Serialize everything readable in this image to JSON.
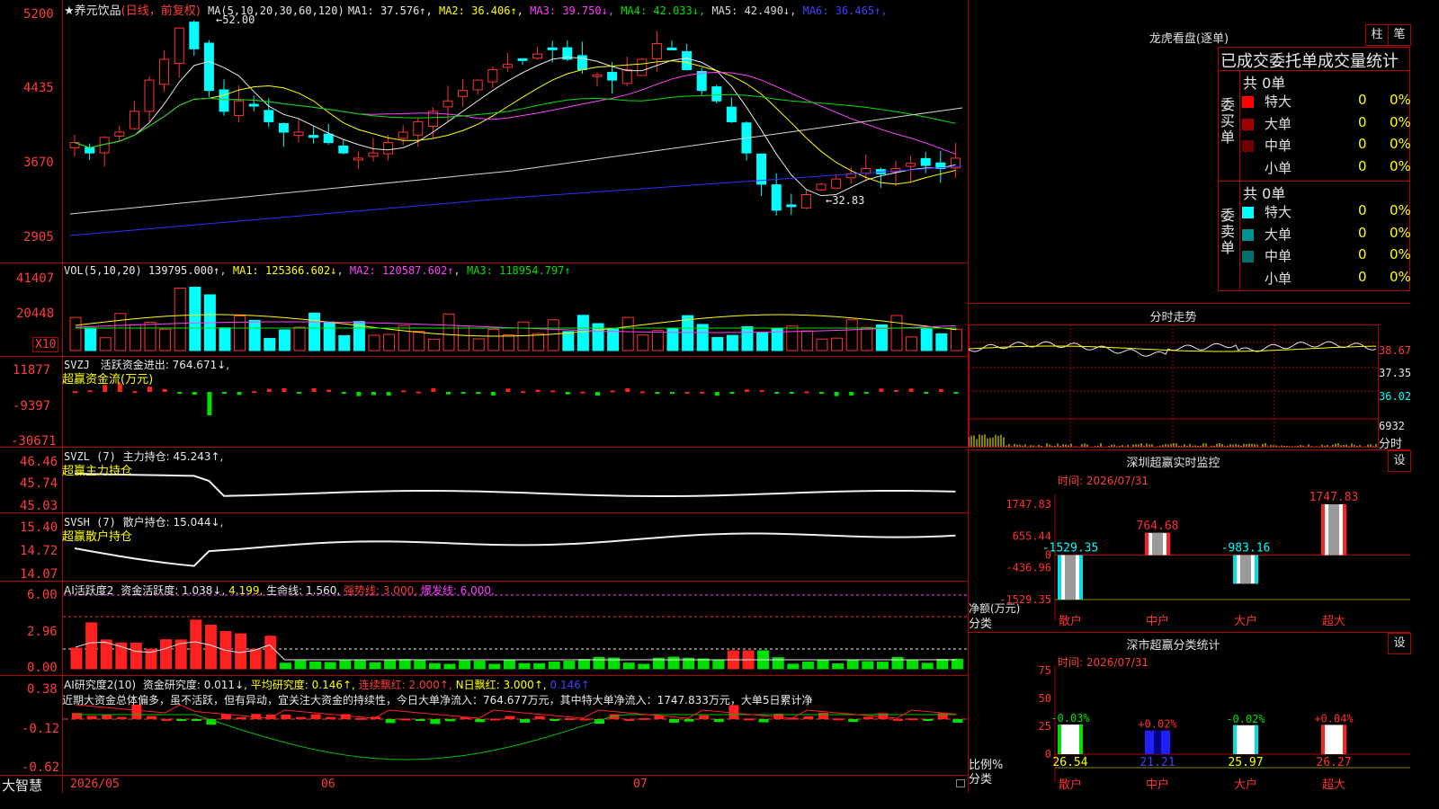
{
  "stock": {
    "star": "★",
    "name": "养元饮品",
    "mode": "(日线，前复权)"
  },
  "ma_line": {
    "prefix": "MA(5,10,20,30,60,120)",
    "items": [
      {
        "label": "MA1: 37.576↑",
        "color": "#e8e8e8"
      },
      {
        "label": "MA2: 36.406↑",
        "color": "#ffff00"
      },
      {
        "label": "MA3: 39.750↓",
        "color": "#ff40ff"
      },
      {
        "label": "MA4: 42.033↓",
        "color": "#00e000"
      },
      {
        "label": "MA5: 42.490↓",
        "color": "#d8d8d8"
      },
      {
        "label": "MA6: 36.465↑",
        "color": "#4040ff"
      }
    ]
  },
  "price_axis": [
    "5200",
    "4435",
    "3670",
    "2905"
  ],
  "price_marks": {
    "high": "52.00",
    "low": "32.83"
  },
  "vol_line": {
    "prefix": "VOL(5,10,20)",
    "value": "139795.000↑",
    "ma1": "MA1: 125366.602↓",
    "ma2": "MA2: 120587.602↑",
    "ma3": "MA3: 118954.797↑"
  },
  "vol_axis": [
    "41407",
    "20448"
  ],
  "vol_unit": "X10",
  "svzj": {
    "title": "SVZJ",
    "label": "活跃资金进出: 764.671↓,",
    "sub": "超赢资金流(万元)",
    "axis": [
      "11877",
      "-9397",
      "-30671"
    ]
  },
  "svzl": {
    "title": "SVZL (7)",
    "label": "主力持仓: 45.243↑,",
    "sub": "超赢主力持仓",
    "axis": [
      "46.46",
      "45.74",
      "45.03"
    ]
  },
  "svsh": {
    "title": "SVSH (7)",
    "label": "散户持仓: 15.044↓,",
    "sub": "超赢散户持仓",
    "axis": [
      "15.40",
      "14.72",
      "14.07"
    ]
  },
  "ai_active": {
    "title": "AI活跃度2",
    "l1": "资金活跃度: 1.038↓,",
    "l2": "4.199,",
    "l3": "生命线: 1.560,",
    "l4": "强势线: 3.000,",
    "l5": "爆发线: 6.000,",
    "axis": [
      "6.00",
      "2.96",
      "0.00"
    ]
  },
  "ai_research": {
    "title": "AI研究度2(10)",
    "l1": "资金研究度: 0.011↓,",
    "l2": "平均研究度: 0.146↑,",
    "l3": "连续飘红: 2.000↑,",
    "l4": "N日飘红: 3.000↑,",
    "l5": "0.146↑",
    "comment": "近期大资金总体偏多，虽不活跃，但有异动，宜关注大资金的持续性，今日大单净流入：764.677万元，其中特大单净流入：1747.833万元，大单5日累计净",
    "axis": [
      "0.38",
      "-0.12",
      "-0.62"
    ]
  },
  "bottom": {
    "brand": "大智慧",
    "dates": [
      "2026/05",
      "06",
      "07"
    ]
  },
  "dragon": {
    "title": "龙虎看盘(逐单)",
    "btn1": "柱",
    "btn2": "笔",
    "header": "已成交委托单成交量统计",
    "buy_label": "委买单",
    "sell_label": "委卖单",
    "buy_total": "共 0单",
    "sell_total": "共 0单",
    "buy_rows": [
      {
        "name": "特大",
        "val": "0",
        "pct": "0%",
        "color": "#ff0000"
      },
      {
        "name": "大单",
        "val": "0",
        "pct": "0%",
        "color": "#a00000"
      },
      {
        "name": "中单",
        "val": "0",
        "pct": "0%",
        "color": "#700000"
      },
      {
        "name": "小单",
        "val": "0",
        "pct": "0%",
        "color": ""
      }
    ],
    "sell_rows": [
      {
        "name": "特大",
        "val": "0",
        "pct": "0%",
        "color": "#00ffff"
      },
      {
        "name": "大单",
        "val": "0",
        "pct": "0%",
        "color": "#009090"
      },
      {
        "name": "中单",
        "val": "0",
        "pct": "0%",
        "color": "#007070"
      },
      {
        "name": "小单",
        "val": "0",
        "pct": "0%",
        "color": ""
      }
    ]
  },
  "intraday": {
    "title": "分时走势",
    "axis": [
      "38.67",
      "37.35",
      "36.02"
    ],
    "vol_axis": "6932",
    "vol_label": "分时"
  },
  "sz_monitor": {
    "title": "深圳超赢实时监控",
    "btn": "设",
    "time": "时间: 2026/07/31",
    "axis": [
      "1747.83",
      "655.44",
      "0",
      "-436.96",
      "-1529.35"
    ],
    "unit": "净额(万元)",
    "cat_label": "分类",
    "chart_data": {
      "type": "bar",
      "categories": [
        "散户",
        "中户",
        "大户",
        "超大"
      ],
      "values": [
        -1529.35,
        764.68,
        -983.16,
        1747.83
      ],
      "ylim": [
        -1529.35,
        1747.83
      ]
    },
    "labels": [
      "-1529.35",
      "764.68",
      "-983.16",
      "1747.83"
    ]
  },
  "sz_class": {
    "title": "深市超赢分类统计",
    "btn": "设",
    "time": "时间: 2026/07/31",
    "axis": [
      "75",
      "50",
      "25",
      "0"
    ],
    "unit": "比例%",
    "cat_label": "分类",
    "chart_data": {
      "type": "bar",
      "categories": [
        "散户",
        "中户",
        "大户",
        "超大"
      ],
      "values": [
        26.54,
        21.21,
        25.97,
        26.27
      ],
      "changes": [
        "-0.03%",
        "+0.02%",
        "-0.02%",
        "+0.04%"
      ],
      "ylim": [
        0,
        75
      ]
    },
    "labels": [
      "26.54",
      "21.21",
      "25.97",
      "26.27"
    ]
  }
}
